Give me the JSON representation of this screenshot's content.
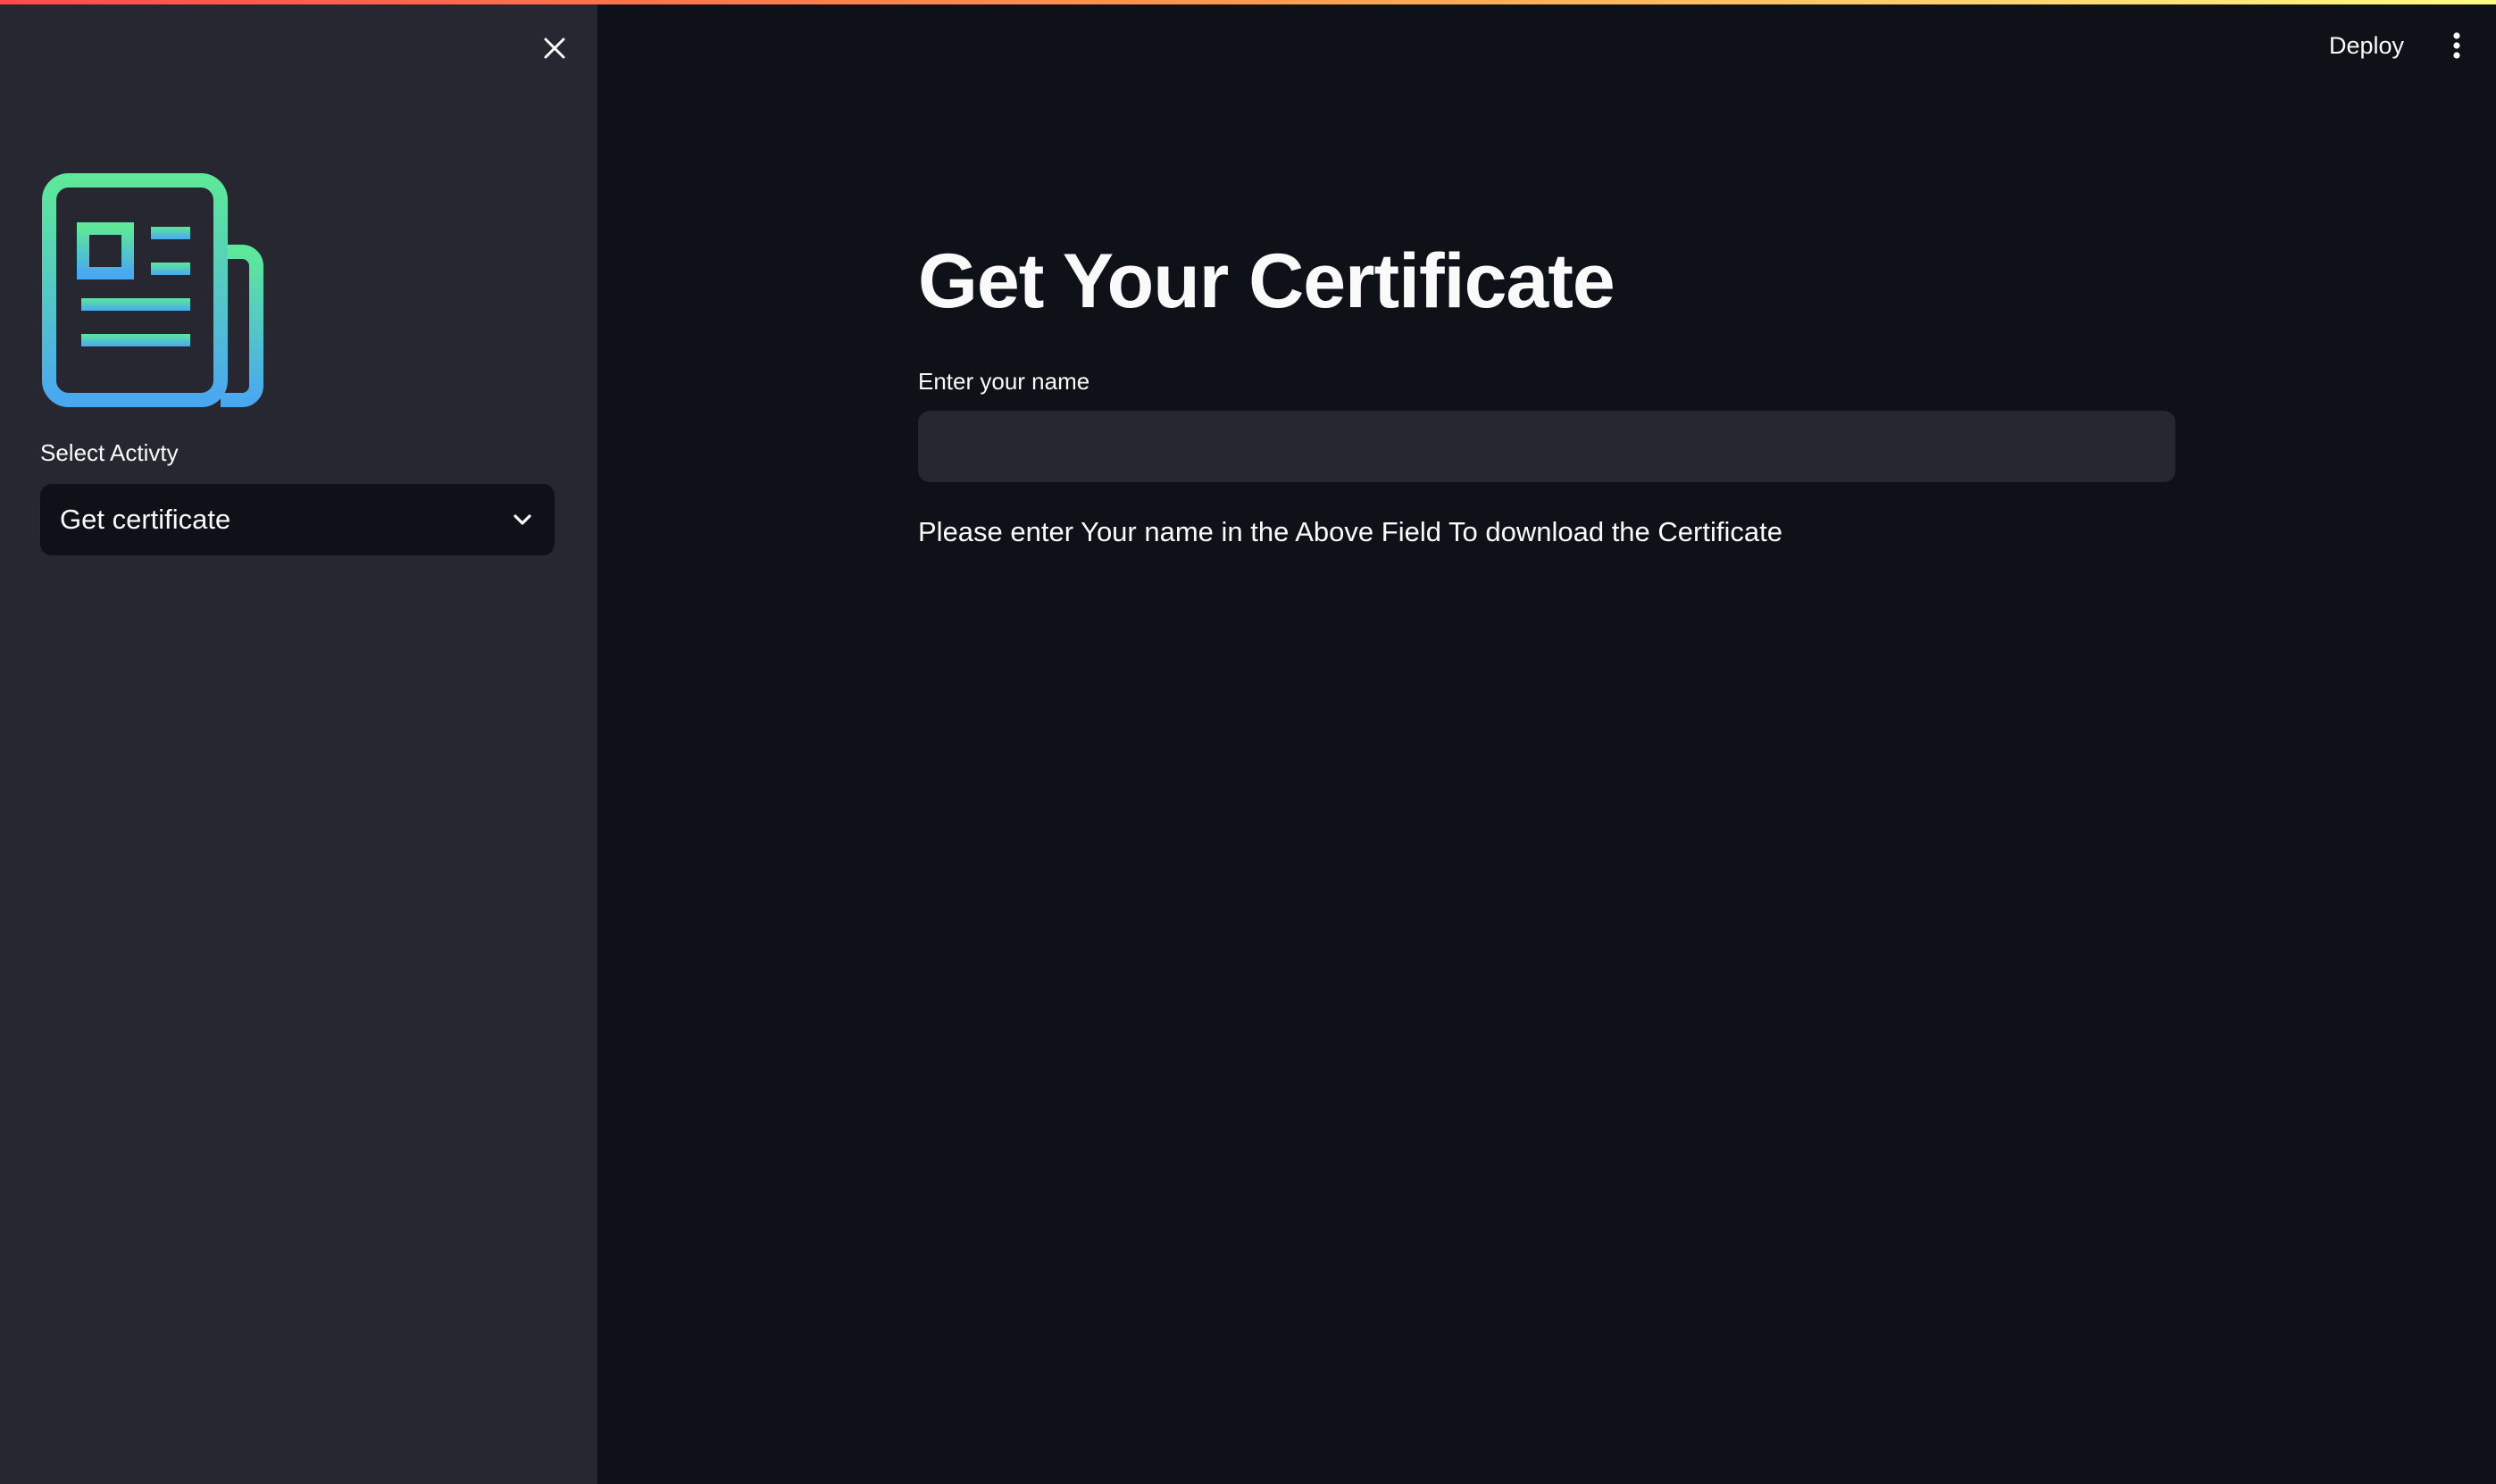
{
  "header": {
    "deploy_label": "Deploy",
    "menu_icon": "more-vertical-icon"
  },
  "sidebar": {
    "close_icon": "close-icon",
    "logo_icon": "newspaper-icon",
    "select_label": "Select Activty",
    "select_value": "Get certificate",
    "select_icon": "chevron-down-icon"
  },
  "main": {
    "title": "Get Your Certificate",
    "input_label": "Enter your name",
    "input_value": "",
    "info_text": "Please enter Your name in the Above Field To download the Certificate"
  },
  "colors": {
    "background": "#0e1117",
    "sidebar": "#262730",
    "input_bg": "#262730",
    "text": "#fafafa",
    "logo_gradient_top": "#5ee89a",
    "logo_gradient_bottom": "#4aa8f0",
    "stripe_start": "#ff4b4b",
    "stripe_end": "#fffd80"
  }
}
